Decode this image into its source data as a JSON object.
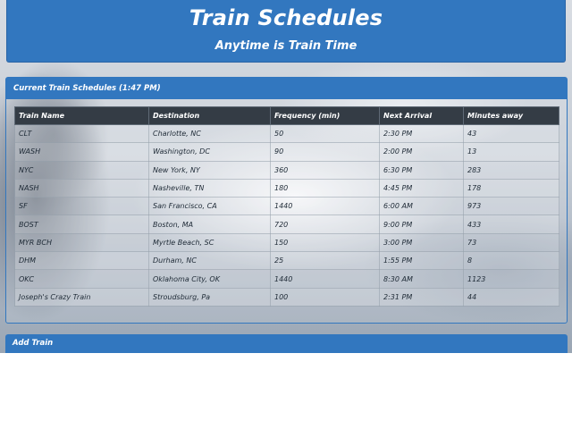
{
  "header": {
    "title": "Train Schedules",
    "subtitle": "Anytime is Train Time"
  },
  "current_panel": {
    "heading": "Current Train Schedules (1:47 PM)"
  },
  "table": {
    "columns": [
      "Train Name",
      "Destination",
      "Frequency (min)",
      "Next Arrival",
      "Minutes away"
    ],
    "rows": [
      [
        "CLT",
        "Charlotte, NC",
        "50",
        "2:30 PM",
        "43"
      ],
      [
        "WASH",
        "Washington, DC",
        "90",
        "2:00 PM",
        "13"
      ],
      [
        "NYC",
        "New York, NY",
        "360",
        "6:30 PM",
        "283"
      ],
      [
        "NASH",
        "Nasheville, TN",
        "180",
        "4:45 PM",
        "178"
      ],
      [
        "SF",
        "San Francisco, CA",
        "1440",
        "6:00 AM",
        "973"
      ],
      [
        "BOST",
        "Boston, MA",
        "720",
        "9:00 PM",
        "433"
      ],
      [
        "MYR BCH",
        "Myrtle Beach, SC",
        "150",
        "3:00 PM",
        "73"
      ],
      [
        "DHM",
        "Durham, NC",
        "25",
        "1:55 PM",
        "8"
      ],
      [
        "OKC",
        "Oklahoma City, OK",
        "1440",
        "8:30 AM",
        "1123"
      ],
      [
        "Joseph's Crazy Train",
        "Stroudsburg, Pa",
        "100",
        "2:31 PM",
        "44"
      ]
    ]
  },
  "add_panel": {
    "heading": "Add Train"
  }
}
